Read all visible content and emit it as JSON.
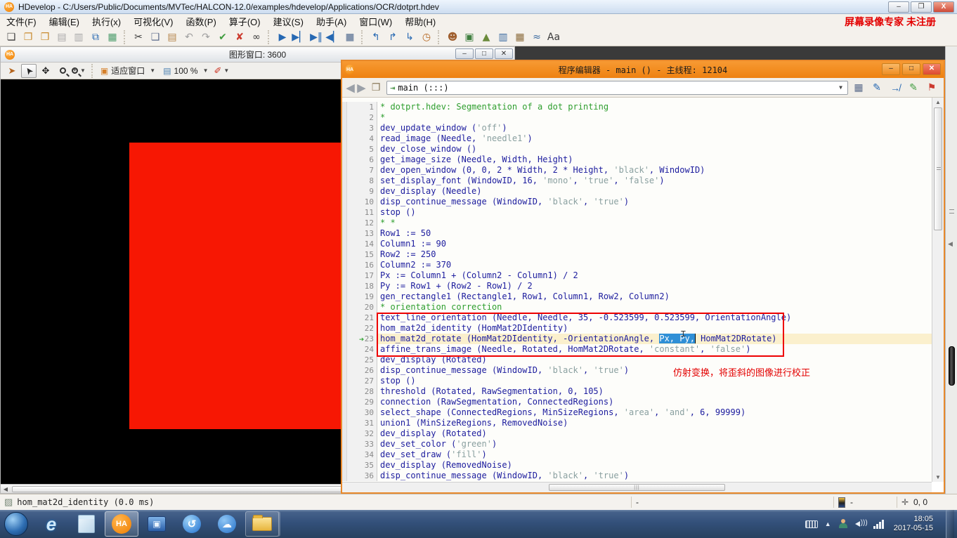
{
  "window": {
    "title": "HDevelop - C:/Users/Public/Documents/MVTec/HALCON-12.0/examples/hdevelop/Applications/OCR/dotprt.hdev",
    "minimize": "–",
    "restore": "❐",
    "close": "X"
  },
  "overlay": {
    "recorder_badge": "屏幕录像专家 未注册"
  },
  "menu": {
    "items": [
      "文件(F)",
      "编辑(E)",
      "执行(x)",
      "可视化(V)",
      "函数(P)",
      "算子(O)",
      "建议(S)",
      "助手(A)",
      "窗口(W)",
      "帮助(H)"
    ]
  },
  "toolbar": {
    "groups": [
      [
        {
          "n": "new-program-icon",
          "g": "❏",
          "c": "#3a3a3a"
        },
        {
          "n": "open-program-icon",
          "g": "❐",
          "c": "#c98a2e"
        },
        {
          "n": "open-example-icon",
          "g": "❒",
          "c": "#c98a2e"
        },
        {
          "n": "save-icon",
          "g": "▤",
          "c": "#a8a8a8"
        },
        {
          "n": "save-as-icon",
          "g": "▥",
          "c": "#a8a8a8"
        },
        {
          "n": "export-program-icon",
          "g": "⧉",
          "c": "#2668b2"
        },
        {
          "n": "screenshot-assistant-icon",
          "g": "▦",
          "c": "#4a9b6a"
        }
      ],
      [
        {
          "n": "cut-icon",
          "g": "✂",
          "c": "#3a3a3a"
        },
        {
          "n": "copy-icon",
          "g": "❑",
          "c": "#5a6a8a"
        },
        {
          "n": "paste-icon",
          "g": "▤",
          "c": "#b5854a"
        },
        {
          "n": "undo-icon",
          "g": "↶",
          "c": "#a0a0a0"
        },
        {
          "n": "redo-icon",
          "g": "↷",
          "c": "#a0a0a0"
        },
        {
          "n": "activate-lines-icon",
          "g": "✔",
          "c": "#3f9c3f"
        },
        {
          "n": "deactivate-lines-icon",
          "g": "✘",
          "c": "#cc3b2f"
        },
        {
          "n": "find-icon",
          "g": "∞",
          "c": "#3a3a3a"
        }
      ],
      [
        {
          "n": "run-icon",
          "g": "▶",
          "c": "#2668b2"
        },
        {
          "n": "step-forward-icon",
          "g": "▶▏",
          "c": "#2668b2"
        },
        {
          "n": "step-over-icon",
          "g": "▶‖",
          "c": "#2668b2"
        },
        {
          "n": "step-into-icon",
          "g": "◀▏",
          "c": "#2668b2"
        },
        {
          "n": "stop-icon",
          "g": "■",
          "c": "#8494ac"
        }
      ],
      [
        {
          "n": "reset-program-icon",
          "g": "↰",
          "c": "#2668b2"
        },
        {
          "n": "set-insert-cursor-icon",
          "g": "↱",
          "c": "#2668b2"
        },
        {
          "n": "goto-entry-icon",
          "g": "↳",
          "c": "#2668b2"
        },
        {
          "n": "profiler-icon",
          "g": "◷",
          "c": "#b5651d"
        }
      ],
      [
        {
          "n": "operator-window-icon",
          "g": "☻",
          "c": "#a06030"
        },
        {
          "n": "image-window-icon",
          "g": "▣",
          "c": "#3f7f3f"
        },
        {
          "n": "zoom-window-icon",
          "g": "▲",
          "c": "#6a8a3a"
        },
        {
          "n": "gray-histogram-icon",
          "g": "▥",
          "c": "#3a6aa0"
        },
        {
          "n": "feature-table-icon",
          "g": "▦",
          "c": "#8a6a3a"
        },
        {
          "n": "feature-histogram-icon",
          "g": "≈",
          "c": "#3a6aa0"
        },
        {
          "n": "font-training-icon",
          "g": "Aa",
          "c": "#3a3a3a"
        }
      ]
    ]
  },
  "graphics_window": {
    "title": "图形窗口: 3600",
    "fit_label": "适应窗口",
    "zoom_value": "100 %",
    "minimize": "–",
    "maximize": "□",
    "close": "✕"
  },
  "editor": {
    "title": "程序编辑器 - main () - 主线程: 12104",
    "nav_combo": "main (:::)",
    "minimize": "–",
    "maximize": "□",
    "close": "✕",
    "annotation": "仿射变换，将歪斜的图像进行校正",
    "hscroll_grip": "|||",
    "lines": [
      {
        "n": 1,
        "seg": [
          [
            "* dotprt.hdev: Segmentation of a dot printing",
            "c"
          ]
        ]
      },
      {
        "n": 2,
        "seg": [
          [
            "*",
            "c"
          ]
        ]
      },
      {
        "n": 3,
        "seg": [
          [
            "dev_update_window (",
            "k"
          ],
          [
            "'off'",
            "s"
          ],
          [
            ")",
            "k"
          ]
        ]
      },
      {
        "n": 4,
        "seg": [
          [
            "read_image (Needle, ",
            "k"
          ],
          [
            "'needle1'",
            "s"
          ],
          [
            ")",
            "k"
          ]
        ]
      },
      {
        "n": 5,
        "seg": [
          [
            "dev_close_window ()",
            "k"
          ]
        ]
      },
      {
        "n": 6,
        "seg": [
          [
            "get_image_size (Needle, Width, Height)",
            "k"
          ]
        ]
      },
      {
        "n": 7,
        "seg": [
          [
            "dev_open_window (0, 0, 2 * Width, 2 * Height, ",
            "k"
          ],
          [
            "'black'",
            "s"
          ],
          [
            ", WindowID)",
            "k"
          ]
        ]
      },
      {
        "n": 8,
        "seg": [
          [
            "set_display_font (WindowID, 16, ",
            "k"
          ],
          [
            "'mono'",
            "s"
          ],
          [
            ", ",
            "k"
          ],
          [
            "'true'",
            "s"
          ],
          [
            ", ",
            "k"
          ],
          [
            "'false'",
            "s"
          ],
          [
            ")",
            "k"
          ]
        ]
      },
      {
        "n": 9,
        "seg": [
          [
            "dev_display (Needle)",
            "k"
          ]
        ]
      },
      {
        "n": 10,
        "seg": [
          [
            "disp_continue_message (WindowID, ",
            "k"
          ],
          [
            "'black'",
            "s"
          ],
          [
            ", ",
            "k"
          ],
          [
            "'true'",
            "s"
          ],
          [
            ")",
            "k"
          ]
        ]
      },
      {
        "n": 11,
        "seg": [
          [
            "stop ()",
            "k"
          ]
        ]
      },
      {
        "n": 12,
        "seg": [
          [
            "* *",
            "c"
          ]
        ]
      },
      {
        "n": 13,
        "seg": [
          [
            "Row1 := 50",
            "k"
          ]
        ]
      },
      {
        "n": 14,
        "seg": [
          [
            "Column1 := 90",
            "k"
          ]
        ]
      },
      {
        "n": 15,
        "seg": [
          [
            "Row2 := 250",
            "k"
          ]
        ]
      },
      {
        "n": 16,
        "seg": [
          [
            "Column2 := 370",
            "k"
          ]
        ]
      },
      {
        "n": 17,
        "seg": [
          [
            "Px := Column1 + (Column2 - Column1) / 2",
            "k"
          ]
        ]
      },
      {
        "n": 18,
        "seg": [
          [
            "Py := Row1 + (Row2 - Row1) / 2",
            "k"
          ]
        ]
      },
      {
        "n": 19,
        "seg": [
          [
            "gen_rectangle1 (Rectangle1, Row1, Column1, Row2, Column2)",
            "k"
          ]
        ]
      },
      {
        "n": 20,
        "seg": [
          [
            "* orientation correction",
            "c"
          ]
        ]
      },
      {
        "n": 21,
        "seg": [
          [
            "text_line_orientation (Needle, Needle, 35, -0.523599, 0.523599, OrientationAngle)",
            "k"
          ]
        ]
      },
      {
        "n": 22,
        "seg": [
          [
            "hom_mat2d_identity (HomMat2DIdentity)",
            "k"
          ]
        ]
      },
      {
        "n": 23,
        "current": true,
        "seg": [
          [
            "hom_mat2d_rotate (HomMat2DIdentity, -OrientationAngle, ",
            "k"
          ],
          [
            "Px, Py,",
            "sel"
          ],
          [
            " HomMat2DRotate)",
            "k"
          ]
        ]
      },
      {
        "n": 24,
        "seg": [
          [
            "affine_trans_image (Needle, Rotated, HomMat2DRotate, ",
            "k"
          ],
          [
            "'constant'",
            "s"
          ],
          [
            ", ",
            "k"
          ],
          [
            "'false'",
            "s"
          ],
          [
            ")",
            "k"
          ]
        ]
      },
      {
        "n": 25,
        "seg": [
          [
            "dev_display (Rotated)",
            "k"
          ]
        ]
      },
      {
        "n": 26,
        "seg": [
          [
            "disp_continue_message (WindowID, ",
            "k"
          ],
          [
            "'black'",
            "s"
          ],
          [
            ", ",
            "k"
          ],
          [
            "'true'",
            "s"
          ],
          [
            ")",
            "k"
          ]
        ]
      },
      {
        "n": 27,
        "seg": [
          [
            "stop ()",
            "k"
          ]
        ]
      },
      {
        "n": 28,
        "seg": [
          [
            "threshold (Rotated, RawSegmentation, 0, 105)",
            "k"
          ]
        ]
      },
      {
        "n": 29,
        "seg": [
          [
            "connection (RawSegmentation, ConnectedRegions)",
            "k"
          ]
        ]
      },
      {
        "n": 30,
        "seg": [
          [
            "select_shape (ConnectedRegions, MinSizeRegions, ",
            "k"
          ],
          [
            "'area'",
            "s"
          ],
          [
            ", ",
            "k"
          ],
          [
            "'and'",
            "s"
          ],
          [
            ", 6, 99999)",
            "k"
          ]
        ]
      },
      {
        "n": 31,
        "seg": [
          [
            "union1 (MinSizeRegions, RemovedNoise)",
            "k"
          ]
        ]
      },
      {
        "n": 32,
        "seg": [
          [
            "dev_display (Rotated)",
            "k"
          ]
        ]
      },
      {
        "n": 33,
        "seg": [
          [
            "dev_set_color (",
            "k"
          ],
          [
            "'green'",
            "s"
          ],
          [
            ")",
            "k"
          ]
        ]
      },
      {
        "n": 34,
        "seg": [
          [
            "dev_set_draw (",
            "k"
          ],
          [
            "'fill'",
            "s"
          ],
          [
            ")",
            "k"
          ]
        ]
      },
      {
        "n": 35,
        "seg": [
          [
            "dev_display (RemovedNoise)",
            "k"
          ]
        ]
      },
      {
        "n": 36,
        "seg": [
          [
            "disp_continue_message (WindowID, ",
            "k"
          ],
          [
            "'black'",
            "s"
          ],
          [
            ", ",
            "k"
          ],
          [
            "'true'",
            "s"
          ],
          [
            ")",
            "k"
          ]
        ]
      }
    ]
  },
  "status_bar": {
    "message": "hom_mat2d_identity (0.0 ms)",
    "dash1": "-",
    "dash2": "-",
    "coords": "0,  0"
  },
  "taskbar": {
    "clock_time": "18:05",
    "clock_date": "2017-05-15",
    "flag_colors": [
      "#f25022",
      "#7fba00",
      "#00a4ef",
      "#ffb900"
    ]
  }
}
